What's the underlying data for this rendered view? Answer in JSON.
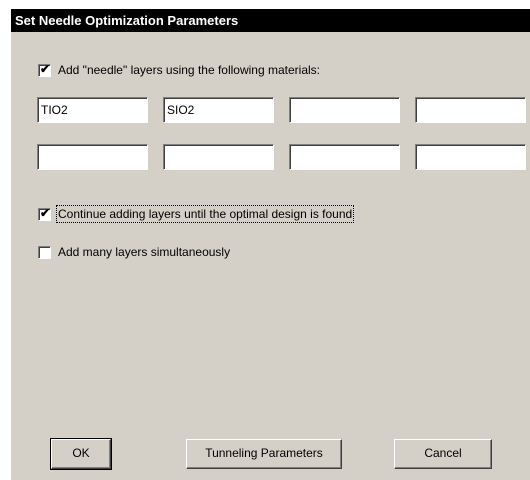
{
  "dialog": {
    "title": "Set Needle Optimization Parameters"
  },
  "options": {
    "add_needle_label": "Add \"needle\" layers using the following materials:",
    "add_needle_checked": true,
    "continue_label": "Continue adding layers until the optimal design is found",
    "continue_checked": true,
    "many_layers_label": "Add many layers simultaneously",
    "many_layers_checked": false
  },
  "materials": [
    "TIO2",
    "SIO2",
    "",
    "",
    "",
    "",
    "",
    ""
  ],
  "buttons": {
    "ok": "OK",
    "tunneling": "Tunneling Parameters",
    "cancel": "Cancel"
  },
  "check_glyph": "✔"
}
